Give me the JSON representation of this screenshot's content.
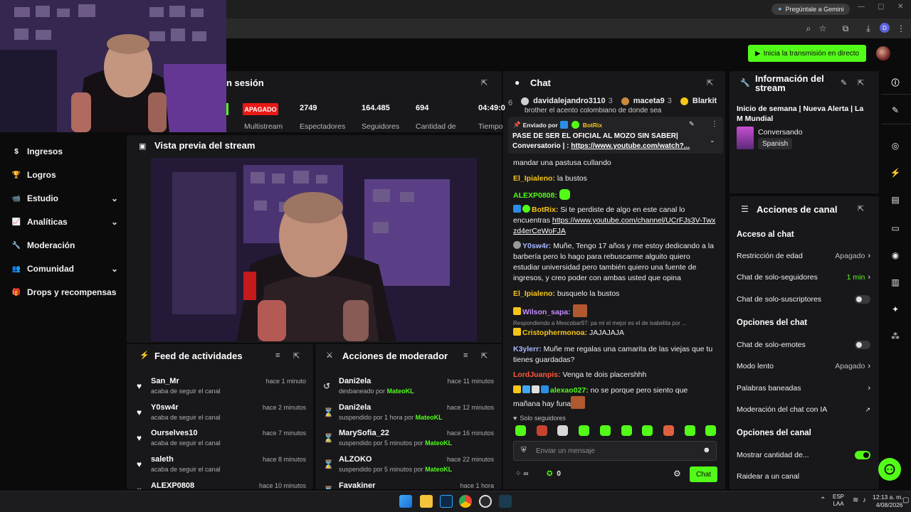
{
  "browser": {
    "gemini_label": "Pregúntale a Gemini",
    "profile_initial": "D"
  },
  "header": {
    "go_live_label": "Inicia la transmisión en directo"
  },
  "colors": {
    "brand": "#53fc18",
    "offline_badge": "#e91916",
    "panel": "#18181b",
    "background": "#0b0b0c"
  },
  "sidebar": {
    "items": [
      {
        "label": "Ingresos",
        "icon": "dollar-icon",
        "chevron": false
      },
      {
        "label": "Logros",
        "icon": "trophy-icon",
        "chevron": false
      },
      {
        "label": "Estudio",
        "icon": "video-camera-icon",
        "chevron": true
      },
      {
        "label": "Analíticas",
        "icon": "chart-icon",
        "chevron": true
      },
      {
        "label": "Moderación",
        "icon": "wrench-icon",
        "chevron": false
      },
      {
        "label": "Comunidad",
        "icon": "people-icon",
        "chevron": true
      },
      {
        "label": "Drops y recompensas",
        "icon": "gift-icon",
        "chevron": false
      }
    ]
  },
  "session": {
    "title_partial": "n sesión",
    "status_badge": "APAGADO",
    "stats": [
      {
        "value": "",
        "label": "Multistream"
      },
      {
        "value": "2749",
        "label": "Espectadores"
      },
      {
        "value": "164.485",
        "label": "Seguidores"
      },
      {
        "value": "694",
        "label": "Cantidad de"
      },
      {
        "value": "04:49:0",
        "label": "Tiempo"
      }
    ]
  },
  "preview": {
    "title": "Vista previa del stream"
  },
  "activity_feed": {
    "title": "Feed de actividades",
    "items": [
      {
        "name": "San_Mr",
        "action": "acaba de seguir el canal",
        "time": "hace 1 minuto"
      },
      {
        "name": "Y0sw4r",
        "action": "acaba de seguir el canal",
        "time": "hace 2 minutos"
      },
      {
        "name": "Ourselves10",
        "action": "acaba de seguir el canal",
        "time": "hace 7 minutos"
      },
      {
        "name": "saleth",
        "action": "acaba de seguir el canal",
        "time": "hace 8 minutos"
      },
      {
        "name": "ALEXP0808",
        "action": "",
        "time": "hace 10 minutos"
      }
    ]
  },
  "mod_actions": {
    "title": "Acciones de moderador",
    "items": [
      {
        "name": "Dani2ela",
        "action": "desbaneado por",
        "mod": "MateoKL",
        "time": "hace 11 minutos",
        "icon": "undo-icon"
      },
      {
        "name": "Dani2ela",
        "action": "suspendido por 1 hora por",
        "mod": "MateoKL",
        "time": "hace 12 minutos",
        "icon": "hourglass-icon"
      },
      {
        "name": "MarySofia_22",
        "action": "suspendido por 5 minutos por",
        "mod": "MateoKL",
        "time": "hace 16 minutos",
        "icon": "hourglass-icon"
      },
      {
        "name": "ALZOKO",
        "action": "suspendido por 5 minutos por",
        "mod": "MateoKL",
        "time": "hace 22 minutos",
        "icon": "hourglass-icon"
      },
      {
        "name": "Favakiner",
        "action": "",
        "mod": "",
        "time": "hace 1 hora",
        "icon": "hourglass-icon"
      }
    ]
  },
  "chat": {
    "title": "Chat",
    "leaderboard": [
      {
        "rank": "6",
        "name": ""
      },
      {
        "rank": "",
        "name": "davidalejandro3110",
        "count": "3"
      },
      {
        "rank": "",
        "name": "maceta9",
        "count": "3"
      },
      {
        "rank": "",
        "name": "Blarkit",
        "count": ""
      }
    ],
    "partial_top_line": "brother el acento colombiano de donde sea",
    "pinned": {
      "sent_by_label": "Enviado por",
      "sender": "BotRix",
      "text": "PASE DE SER EL OFICIAL AL MOZO SIN SABER| Conversatorio | :",
      "link": "https://www.youtube.com/watch?..."
    },
    "messages": [
      {
        "user": "",
        "color": "#ffffff",
        "text": "mandar una pastusa cullando"
      },
      {
        "user": "El_Ipialeno",
        "color": "#f5c518",
        "text": "la bustos"
      },
      {
        "user": "ALEXP0808",
        "color": "#53fc18",
        "text": ""
      },
      {
        "user": "BotRix",
        "color": "#f5c518",
        "text": "Si te perdiste de algo en este canal lo encuentras",
        "link": "https://www.youtube.com/channel/UCrFJs3V-Twxzd4erCeWoFJA"
      },
      {
        "user": "Y0sw4r",
        "color": "#a6b8ff",
        "text": "Muñe, Tengo 17 años y me estoy dedicando a la barbería pero lo hago para rebuscarme alguito quiero estudiar universidad pero también quiero una fuente de ingresos, y creo poder con ambas usted que opina"
      },
      {
        "user": "El_Ipialeno",
        "color": "#f5c518",
        "text": "busquelo la bustos"
      },
      {
        "user": "Wilson_sapa",
        "color": "#c58cff",
        "text": ""
      },
      {
        "reply_to": "Respondiendo a Mescobar97: pa mi el mejor es el de isabelita por ..."
      },
      {
        "user": "Cristophermonoa",
        "color": "#f5c518",
        "text": "JAJAJAJA"
      },
      {
        "user": "K3ylerr",
        "color": "#a6b8ff",
        "text": "Muñe me regalas una camarita de las viejas que tu tienes guardadas?"
      },
      {
        "user": "LordJuanpis",
        "color": "#ff5a3c",
        "text": "Venga te dois placershhh"
      },
      {
        "user": "alexao027",
        "color": "#53fc18",
        "text": "no se porque pero siento que mañana hay funa"
      }
    ],
    "mode_label": "Solo seguidores",
    "input_placeholder": "Enviar un mensaje",
    "infinity_count": "∞",
    "points_count": "0",
    "send_label": "Chat"
  },
  "stream_info": {
    "title": "Información del stream",
    "stream_title": "Inicio de semana | Nueva Alerta | La M Mundial",
    "category": "Conversando",
    "language": "Spanish"
  },
  "channel_actions": {
    "title": "Acciones de canal",
    "sections": [
      {
        "heading": "Acceso al chat",
        "options": [
          {
            "label": "Restricción de edad",
            "value": "Apagado",
            "control": "chevron"
          },
          {
            "label": "Chat de solo-seguidores",
            "value": "1 min",
            "control": "chevron",
            "value_color": "#53fc18"
          },
          {
            "label": "Chat de solo-suscriptores",
            "value": "",
            "control": "toggle-off"
          }
        ]
      },
      {
        "heading": "Opciones del chat",
        "options": [
          {
            "label": "Chat de solo-emotes",
            "value": "",
            "control": "toggle-off"
          },
          {
            "label": "Modo lento",
            "value": "Apagado",
            "control": "chevron"
          },
          {
            "label": "Palabras baneadas",
            "value": "",
            "control": "chevron"
          },
          {
            "label": "Moderación del chat con IA",
            "value": "",
            "control": "external"
          }
        ]
      },
      {
        "heading": "Opciones del canal",
        "options": [
          {
            "label": "Mostrar cantidad de...",
            "value": "",
            "control": "toggle-on"
          },
          {
            "label": "Raidear a un canal",
            "value": "",
            "control": "none"
          }
        ]
      }
    ]
  },
  "taskbar": {
    "lang_line1": "ESP",
    "lang_line2": "LAA",
    "time": "12:13 a. m.",
    "date": "4/08/2026"
  }
}
